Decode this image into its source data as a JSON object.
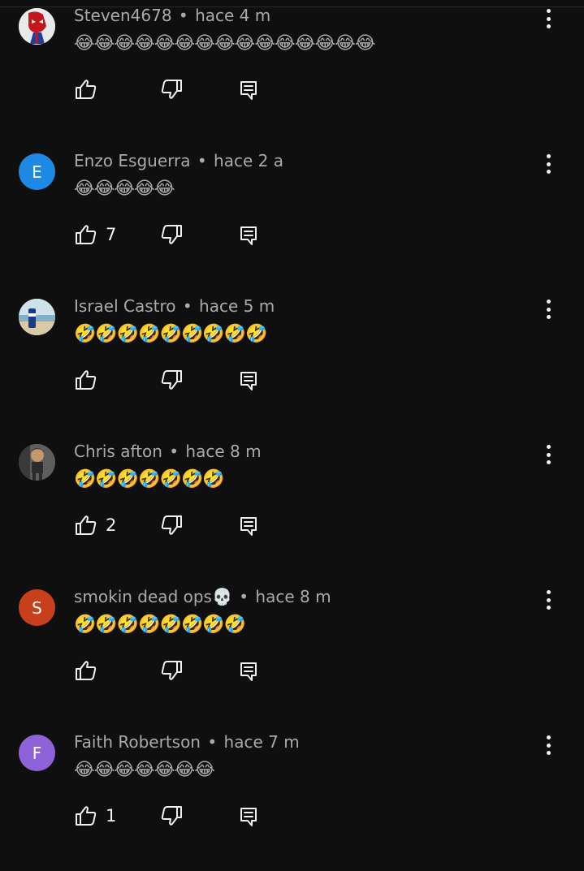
{
  "comments": [
    {
      "author": "Steven4678",
      "time": "hace 4 m",
      "text": "😂😂😂😂😂😂😂😂😂😂😂😂😂😂😂",
      "likes": "",
      "avatar": {
        "type": "image",
        "name": "spiderman-avatar",
        "bg": "#e9e9e9"
      }
    },
    {
      "author": "Enzo Esguerra",
      "time": "hace 2 a",
      "text": "😂😂😂😂😂",
      "likes": "7",
      "avatar": {
        "type": "letter",
        "letter": "E",
        "bg": "#1e88e5"
      }
    },
    {
      "author": "Israel Castro",
      "time": "hace 5 m",
      "text": "🤣🤣🤣🤣🤣🤣🤣🤣🤣",
      "likes": "",
      "avatar": {
        "type": "image",
        "name": "beach-can-avatar",
        "bg": "#bcd3dd"
      }
    },
    {
      "author": "Chris afton",
      "time": "hace 8 m",
      "text": "🤣🤣🤣🤣🤣🤣🤣",
      "likes": "2",
      "avatar": {
        "type": "image",
        "name": "character-avatar",
        "bg": "#6d6d6d"
      }
    },
    {
      "author": "smokin dead ops💀",
      "time": "hace 8 m",
      "text": "🤣🤣🤣🤣🤣🤣🤣🤣",
      "likes": "",
      "avatar": {
        "type": "letter",
        "letter": "S",
        "bg": "#c7401b"
      }
    },
    {
      "author": "Faith Robertson",
      "time": "hace 7 m",
      "text": "😂😂😂😂😂😂😂",
      "likes": "1",
      "avatar": {
        "type": "letter",
        "letter": "F",
        "bg": "#8e62d8"
      }
    }
  ],
  "separator": "•",
  "icons": {
    "like": "thumbs-up-icon",
    "dislike": "thumbs-down-icon",
    "reply": "comment-icon",
    "menu": "more-vert-icon"
  }
}
